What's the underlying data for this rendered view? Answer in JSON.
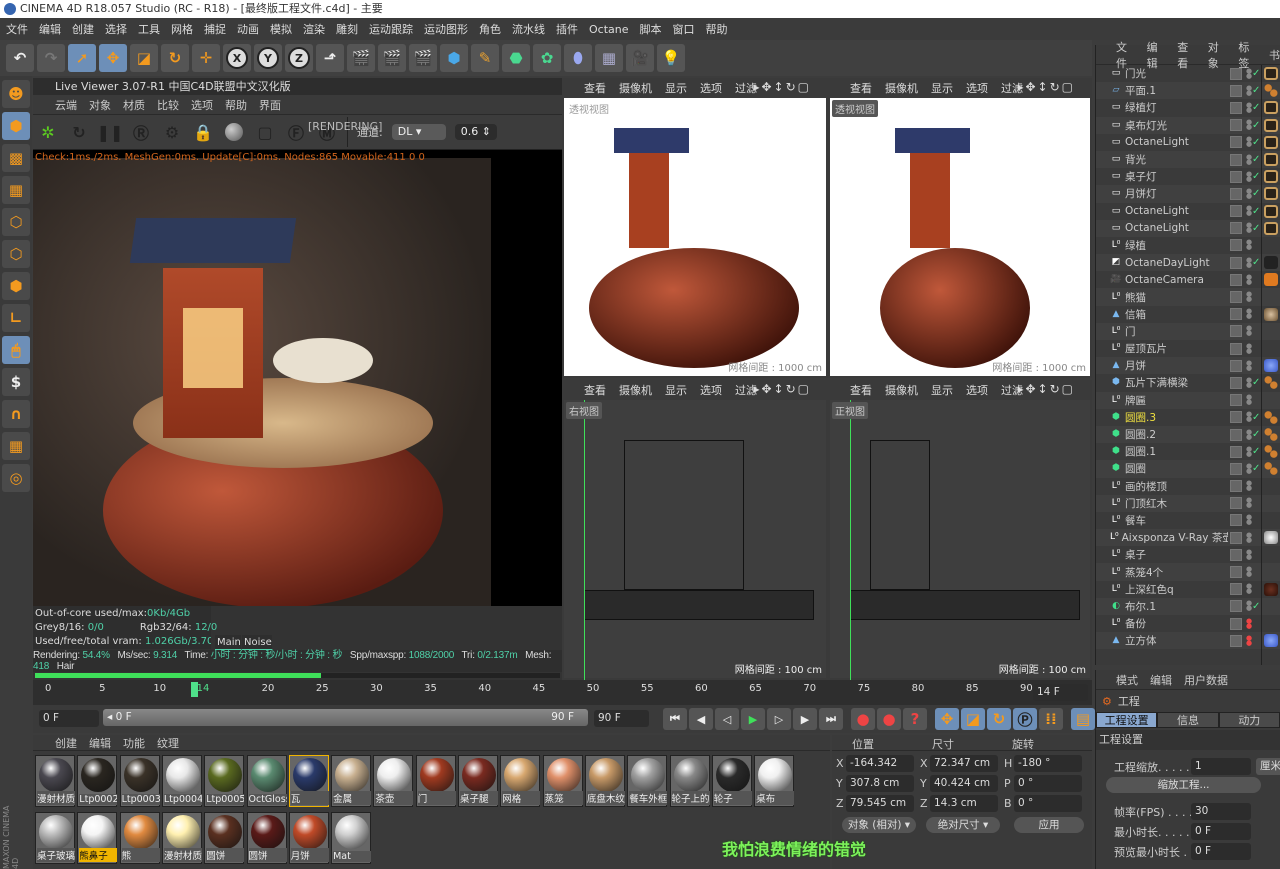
{
  "app": {
    "title": "CINEMA 4D R18.057 Studio (RC - R18) - [最终版工程文件.c4d] - 主要"
  },
  "menu": [
    "文件",
    "编辑",
    "创建",
    "选择",
    "工具",
    "网格",
    "捕捉",
    "动画",
    "模拟",
    "渲染",
    "雕刻",
    "运动跟踪",
    "运动图形",
    "角色",
    "流水线",
    "插件",
    "Octane",
    "脚本",
    "窗口",
    "帮助"
  ],
  "live_viewer": {
    "title": "Live Viewer 3.07-R1 中国C4D联盟中文汉化版",
    "menu": [
      "云端",
      "对象",
      "材质",
      "比较",
      "选项",
      "帮助",
      "界面"
    ],
    "status": "[RENDERING]",
    "channel_label": "通道:",
    "channel_value": "DL",
    "channel_amount": "0.6",
    "check_line": "Check:1ms./2ms. MeshGen:0ms. Update[C]:0ms. Nodes:865 Movable:411  0 0",
    "stats": {
      "ooc_label": "Out-of-core used/max:",
      "ooc_value": "0Kb/4Gb",
      "grey_label": "Grey8/16: ",
      "grey_value": "0/0",
      "rgb_label": "Rgb32/64: ",
      "rgb_value": "12/0",
      "vram_label": "Used/free/total vram: ",
      "vram_value": "1.026Gb/3.703Gb/6G",
      "tab_main": "Main",
      "tab_noise": "Noise"
    },
    "render_line": {
      "rendering_label": "Rendering: ",
      "rendering_value": "54.4%",
      "ms_label": "Ms/sec: ",
      "ms_value": "9.314",
      "time_label": "Time: ",
      "time_value": "小时 : 分钟 : 秒/小时 : 分钟 : 秒",
      "spp_label": "Spp/maxspp: ",
      "spp_value": "1088/2000",
      "tri_label": "Tri: ",
      "tri_value": "0/2.137m",
      "mesh_label": "Mesh: ",
      "mesh_value": "418",
      "hair_label": "Hair"
    },
    "progress_percent": 54.4
  },
  "viewports": [
    {
      "menu": [
        "查看",
        "摄像机",
        "显示",
        "选项",
        "过滤"
      ],
      "label": "透视视图",
      "grid": "网格间距 : 1000 cm"
    },
    {
      "menu": [
        "查看",
        "摄像机",
        "显示",
        "选项",
        "过滤"
      ],
      "label": "透视视图",
      "grid": "网格间距 : 1000 cm"
    },
    {
      "menu": [
        "查看",
        "摄像机",
        "显示",
        "选项",
        "过滤"
      ],
      "label": "右视图",
      "grid": "网格间距 : 100 cm"
    },
    {
      "menu": [
        "查看",
        "摄像机",
        "显示",
        "选项",
        "过滤"
      ],
      "label": "正视图",
      "grid": "网格间距 : 100 cm"
    }
  ],
  "object_manager": {
    "menu": [
      "文件",
      "编辑",
      "查看",
      "对象",
      "标签",
      "书"
    ],
    "objects": [
      {
        "name": "门光",
        "icon": "light-icon",
        "check": true,
        "tag": "octane-light-tag"
      },
      {
        "name": "平面.1",
        "icon": "plane-icon",
        "check": true,
        "tag": "material-dots-tag"
      },
      {
        "name": "绿植灯",
        "icon": "light-icon",
        "check": true,
        "tag": "octane-light-tag"
      },
      {
        "name": "桌布灯光",
        "icon": "light-icon",
        "check": true,
        "tag": "octane-light-tag"
      },
      {
        "name": "OctaneLight",
        "icon": "light-icon",
        "check": true,
        "tag": "octane-light-tag"
      },
      {
        "name": "背光",
        "icon": "light-icon",
        "check": true,
        "tag": "octane-light-tag"
      },
      {
        "name": "桌子灯",
        "icon": "light-icon",
        "check": true,
        "tag": "octane-light-tag"
      },
      {
        "name": "月饼灯",
        "icon": "light-icon",
        "check": true,
        "tag": "octane-light-tag"
      },
      {
        "name": "OctaneLight",
        "icon": "light-icon",
        "check": true,
        "tag": "octane-light-tag"
      },
      {
        "name": "OctaneLight",
        "icon": "light-icon",
        "check": true,
        "tag": "octane-light-tag"
      },
      {
        "name": "绿植",
        "icon": "null-icon",
        "check": false,
        "tag": ""
      },
      {
        "name": "OctaneDayLight",
        "icon": "daylight-icon",
        "check": true,
        "tag": "sun-tag"
      },
      {
        "name": "OctaneCamera",
        "icon": "camera-icon",
        "check": false,
        "tag": "camera-tag"
      },
      {
        "name": "熊猫",
        "icon": "null-icon",
        "check": false,
        "tag": ""
      },
      {
        "name": "信箱",
        "icon": "polygon-icon",
        "check": false,
        "tag": "material-ball-tag"
      },
      {
        "name": "门",
        "icon": "null-icon",
        "check": false,
        "tag": ""
      },
      {
        "name": "屋顶瓦片",
        "icon": "null-icon",
        "check": false,
        "tag": ""
      },
      {
        "name": "月饼",
        "icon": "polygon-icon",
        "check": false,
        "tag": "blue-sphere-tag"
      },
      {
        "name": "瓦片下满横梁",
        "icon": "cube-icon",
        "check": true,
        "tag": "material-dots-tag"
      },
      {
        "name": "牌匾",
        "icon": "null-icon",
        "check": false,
        "tag": ""
      },
      {
        "name": "圆圈.3",
        "icon": "cloner-icon",
        "check": true,
        "tag": "material-dots-tag",
        "highlight": true
      },
      {
        "name": "圆圈.2",
        "icon": "cloner-icon",
        "check": true,
        "tag": "material-dots-tag"
      },
      {
        "name": "圆圈.1",
        "icon": "cloner-icon",
        "check": true,
        "tag": "material-dots-tag"
      },
      {
        "name": "圆圈",
        "icon": "cloner-icon",
        "check": true,
        "tag": "material-dots-tag"
      },
      {
        "name": "画的楼顶",
        "icon": "null-icon",
        "check": false,
        "tag": ""
      },
      {
        "name": "门顶红木",
        "icon": "null-icon",
        "check": false,
        "tag": ""
      },
      {
        "name": "餐车",
        "icon": "null-icon",
        "check": false,
        "tag": ""
      },
      {
        "name": "Aixsponza V-Ray 茶壶",
        "icon": "null-icon",
        "check": false,
        "tag": "white-sphere-tag"
      },
      {
        "name": "桌子",
        "icon": "null-icon",
        "check": false,
        "tag": ""
      },
      {
        "name": "蒸笼4个",
        "icon": "null-icon",
        "check": false,
        "tag": ""
      },
      {
        "name": "上深红色q",
        "icon": "null-icon",
        "check": false,
        "tag": "brown-sphere-tag"
      },
      {
        "name": "布尔.1",
        "icon": "boole-icon",
        "check": true,
        "tag": ""
      },
      {
        "name": "备份",
        "icon": "null-icon",
        "check": false,
        "tag": "",
        "red": true
      },
      {
        "name": "立方体",
        "icon": "polygon-icon",
        "check": false,
        "tag": "blue-sphere-tag",
        "red": true
      }
    ]
  },
  "attributes": {
    "menu": [
      "模式",
      "编辑",
      "用户数据"
    ],
    "title": "工程",
    "tabs": [
      "工程设置",
      "信息",
      "动力"
    ],
    "section": "工程设置",
    "scale_label": "工程缩放. . . . . . .",
    "scale_value": "1",
    "scale_unit": "厘米",
    "scale_button": "缩放工程...",
    "fps_label": "帧率(FPS) . . . . . .",
    "fps_value": "30",
    "min_label": "最小时长. . . . . . .",
    "min_value": "0 F",
    "preview_label": "预览最小时长 . . .",
    "preview_value": "0 F"
  },
  "timeline": {
    "ticks": [
      "0",
      "5",
      "10",
      "14",
      "20",
      "25",
      "30",
      "35",
      "40",
      "45",
      "50",
      "55",
      "60",
      "65",
      "70",
      "75",
      "80",
      "85",
      "90"
    ],
    "current_frame": 14,
    "frame_field": "14 F",
    "start_field": "0 F",
    "range_start": "0 F",
    "range_end": "90 F",
    "end_field": "90 F"
  },
  "materials": {
    "menu": [
      "创建",
      "编辑",
      "功能",
      "纹理"
    ],
    "items": [
      {
        "name": "漫射材质",
        "color": "#4a4850"
      },
      {
        "name": "Ltp0002",
        "color": "#2a2620"
      },
      {
        "name": "Ltp0003",
        "color": "#3a3228"
      },
      {
        "name": "Ltp0004",
        "color": "#e8e8e8"
      },
      {
        "name": "Ltp0005",
        "color": "#5a6a20"
      },
      {
        "name": "OctGloss",
        "color": "#5a8a70"
      },
      {
        "name": "瓦",
        "color": "#2a3a6a",
        "selected": true
      },
      {
        "name": "金属",
        "color": "#c8b090"
      },
      {
        "name": "茶壶",
        "color": "#eeeeee"
      },
      {
        "name": "门",
        "color": "#a03a20"
      },
      {
        "name": "桌子腿",
        "color": "#7a2a20"
      },
      {
        "name": "网格",
        "color": "#d8a870"
      },
      {
        "name": "蒸笼",
        "color": "#e0906a"
      },
      {
        "name": "底盘木纹",
        "color": "#c89a68"
      },
      {
        "name": "餐车外框",
        "color": "#a0a0a0"
      },
      {
        "name": "轮子上的",
        "color": "#888888"
      },
      {
        "name": "轮子",
        "color": "#2a2a2a"
      },
      {
        "name": "桌布",
        "color": "#f0f0f0"
      },
      {
        "name": "桌子玻璃",
        "color": "#bbbbbb"
      },
      {
        "name": "熊鼻子",
        "color": "#f4f4f4",
        "active": true
      },
      {
        "name": "熊",
        "color": "#e08a40"
      },
      {
        "name": "漫射材质",
        "color": "#fff0b0"
      },
      {
        "name": "圆饼",
        "color": "#5a3020"
      },
      {
        "name": "圆饼",
        "color": "#5a1a18"
      },
      {
        "name": "月饼",
        "color": "#c04a28"
      },
      {
        "name": "Mat",
        "color": "#d0d0d0"
      }
    ]
  },
  "coordinates": {
    "headers": [
      "位置",
      "尺寸",
      "旋转"
    ],
    "position": {
      "X": "-164.342 cm",
      "Y": "307.8 cm",
      "Z": "79.545 cm"
    },
    "size": {
      "X": "72.347 cm",
      "Y": "40.424 cm",
      "Z": "14.3 cm"
    },
    "rotation": {
      "H": "-180 °",
      "P": "0 °",
      "B": "0 °"
    },
    "mode": "对象 (相对)",
    "size_mode": "绝对尺寸",
    "apply": "应用"
  },
  "subtitle": "我怕浪费情绪的错觉",
  "colors": {
    "accent": "#6d8fb8",
    "green": "#3fe05a",
    "orange": "#f39a1f",
    "text_cyan": "#4fd1a8"
  }
}
